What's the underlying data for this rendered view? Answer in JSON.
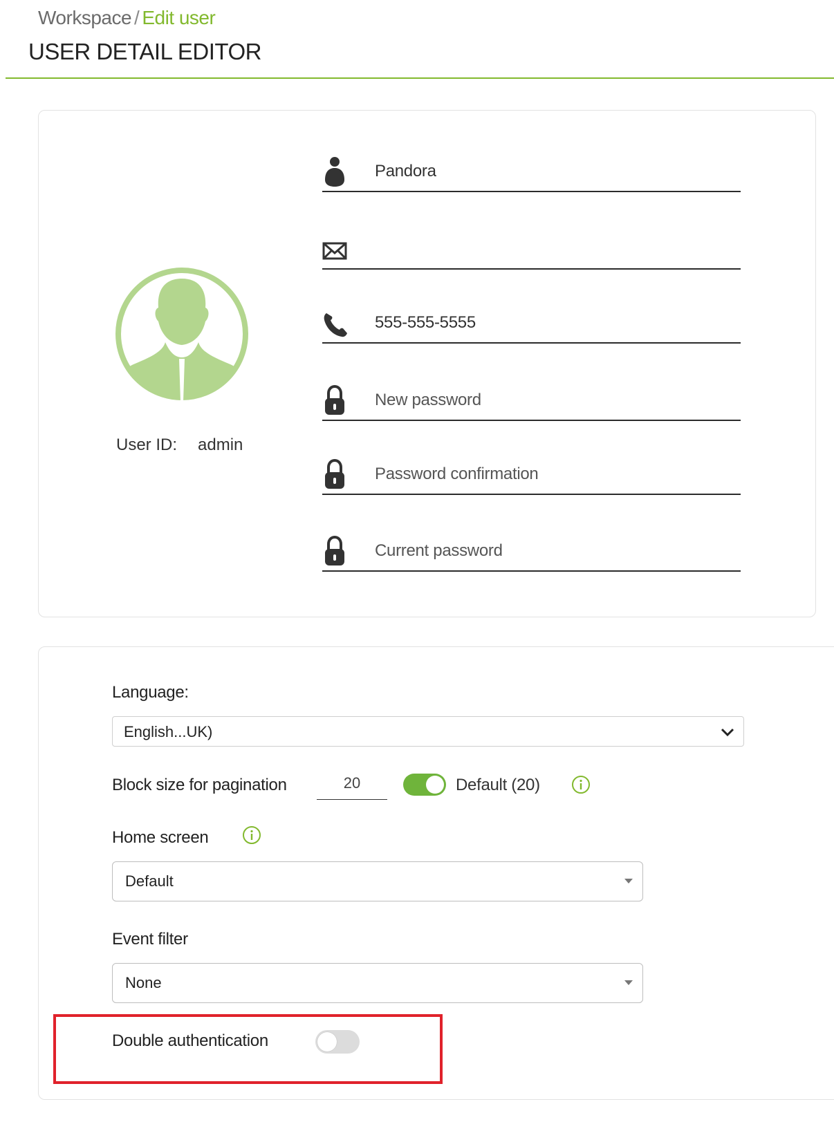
{
  "breadcrumb": {
    "parent": "Workspace",
    "separator": "/",
    "current": "Edit user"
  },
  "page_title": "USER DETAIL EDITOR",
  "colors": {
    "accent": "#82b92e",
    "highlight": "#e0222b",
    "toggle_on": "#6fb43b"
  },
  "profile": {
    "avatar_icon": "user-avatar-icon",
    "user_id_label": "User ID:",
    "user_id_value": "admin"
  },
  "fields": {
    "fullname": {
      "icon": "user-icon",
      "value": "Pandora"
    },
    "email": {
      "icon": "envelope-icon",
      "value": ""
    },
    "phone": {
      "icon": "phone-icon",
      "value": "555-555-5555"
    },
    "new_password": {
      "icon": "lock-icon",
      "placeholder": "New password"
    },
    "password_confirmation": {
      "icon": "lock-icon",
      "placeholder": "Password confirmation"
    },
    "current_password": {
      "icon": "lock-icon",
      "placeholder": "Current password"
    }
  },
  "settings": {
    "language_label": "Language:",
    "language_value": "English...UK)",
    "pagination_label": "Block size for pagination",
    "pagination_value": "20",
    "pagination_default_label": "Default (20)",
    "pagination_default_enabled": true,
    "home_screen_label": "Home screen",
    "home_screen_value": "Default",
    "event_filter_label": "Event filter",
    "event_filter_value": "None",
    "double_auth_label": "Double authentication",
    "double_auth_enabled": false
  }
}
